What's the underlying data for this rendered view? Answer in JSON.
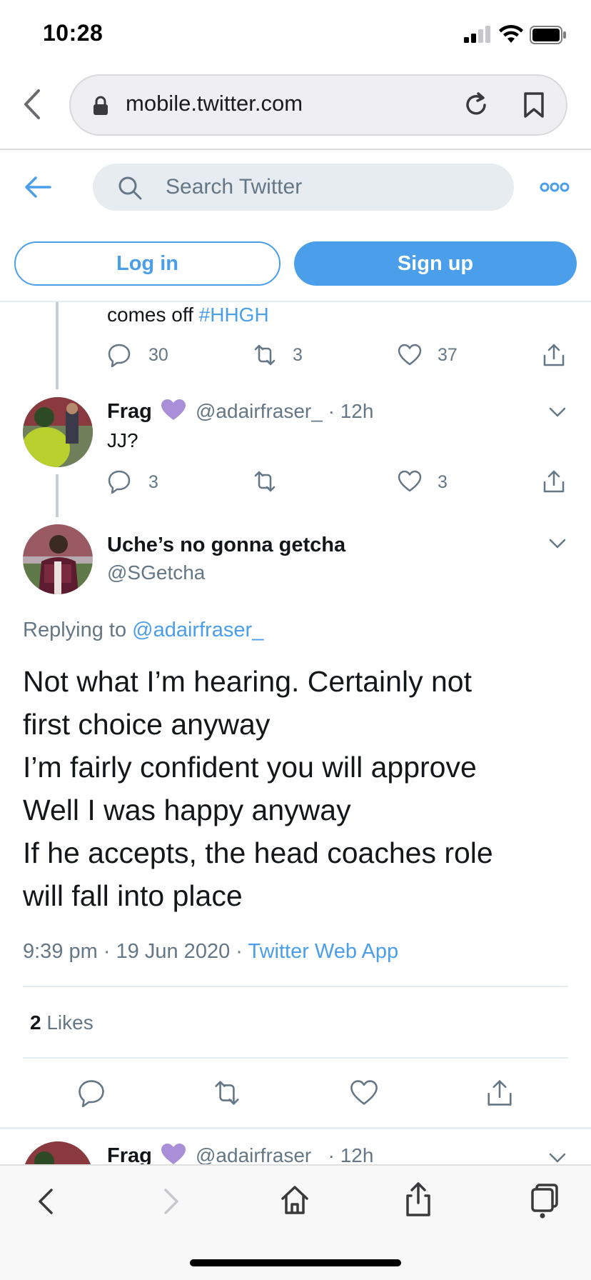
{
  "status_bar": {
    "time": "10:28"
  },
  "browser": {
    "url": "mobile.twitter.com"
  },
  "header": {
    "search_placeholder": "Search Twitter",
    "login_label": "Log in",
    "signup_label": "Sign up"
  },
  "prev_tweet": {
    "text_prefix": "comes off ",
    "hashtag": "#HHGH",
    "replies": "30",
    "retweets": "3",
    "likes": "37"
  },
  "reply_tweet": {
    "name": "Frag",
    "handle": "@adairfraser_",
    "time": "· 12h",
    "text": "JJ?",
    "replies": "3",
    "retweets": "",
    "likes": "3"
  },
  "main_tweet": {
    "name": "Uche’s no gonna getcha",
    "handle": "@SGetcha",
    "replying_prefix": "Replying to ",
    "replying_handle": "@adairfraser_",
    "text": "Not what I’m hearing. Certainly not\nfirst choice anyway\nI’m fairly confident you will approve\nWell I was happy anyway\nIf he accepts, the head coaches role\nwill fall into place",
    "timestamp": "9:39 pm · 19 Jun 2020 · ",
    "source": "Twitter Web App",
    "likes_count": "2",
    "likes_label": "Likes"
  },
  "next_tweet": {
    "name": "Frag",
    "handle": "@adairfraser_",
    "time": "· 12h"
  },
  "colors": {
    "twitter_blue": "#4a9eea",
    "grey_text": "#657786",
    "purple_heart": "#a98fd8"
  }
}
